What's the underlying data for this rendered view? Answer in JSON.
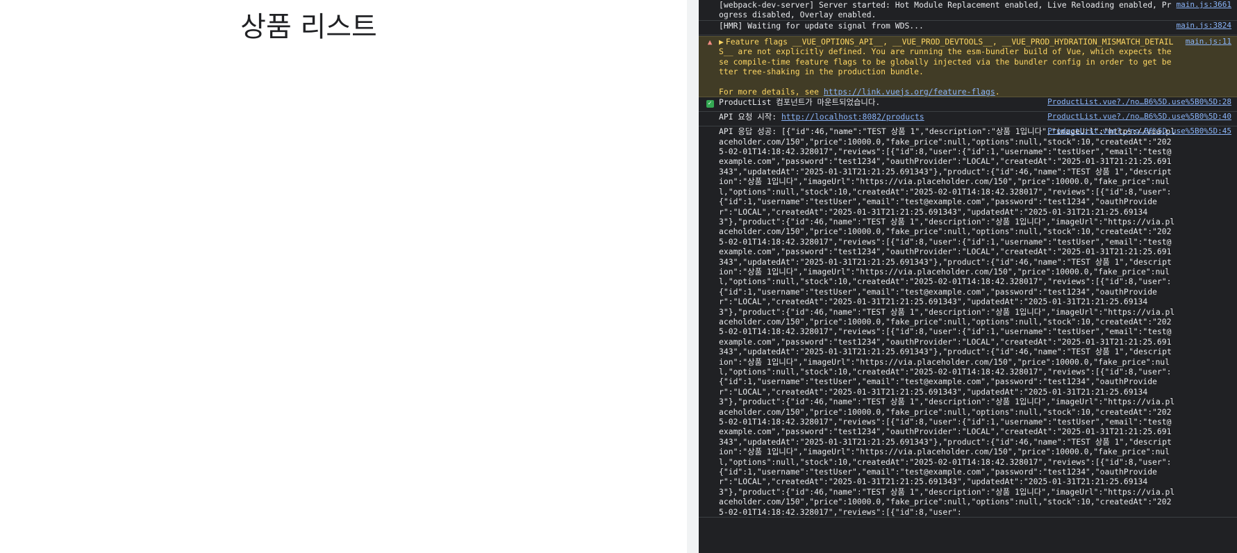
{
  "app": {
    "title": "상품 리스트"
  },
  "console": {
    "messages": [
      {
        "type": "log",
        "text": "[webpack-dev-server] Server started: Hot Module Replacement enabled, Live Reloading enabled, Progress disabled, Overlay enabled.",
        "source": "main.js:3661"
      },
      {
        "type": "log",
        "text": "[HMR] Waiting for update signal from WDS...",
        "source": "main.js:3824"
      },
      {
        "type": "warning",
        "text": "Feature flags __VUE_OPTIONS_API__, __VUE_PROD_DEVTOOLS__, __VUE_PROD_HYDRATION_MISMATCH_DETAILS__ are not explicitly defined. You are running the esm-bundler build of Vue, which expects these compile-time feature flags to be globally injected via the bundler config in order to get better tree-shaking in the production bundle.",
        "details_prefix": "For more details, see ",
        "details_link": "https://link.vuejs.org/feature-flags",
        "details_suffix": ".",
        "source": "main.js:11"
      },
      {
        "type": "log",
        "text": "ProductList 컴포넌트가 마운트되었습니다.",
        "source": "ProductList.vue?./no…B6%5D.use%5B0%5D:28"
      },
      {
        "type": "log",
        "text_prefix": "API 요청 시작: ",
        "link": "http://localhost:8082/products",
        "source": "ProductList.vue?./no…B6%5D.use%5B0%5D:40"
      },
      {
        "type": "log",
        "text": "API 응답 성공: [{\"id\":46,\"name\":\"TEST 상품 1\",\"description\":\"상품 1입니다\",\"imageUrl\":\"https://via.placeholder.com/150\",\"price\":10000.0,\"fake_price\":null,\"options\":null,\"stock\":10,\"createdAt\":\"2025-02-01T14:18:42.328017\",\"reviews\":[{\"id\":8,\"user\":{\"id\":1,\"username\":\"testUser\",\"email\":\"test@example.com\",\"password\":\"test1234\",\"oauthProvider\":\"LOCAL\",\"createdAt\":\"2025-01-31T21:21:25.691343\",\"updatedAt\":\"2025-01-31T21:21:25.691343\"},\"product\":{\"id\":46,\"name\":\"TEST 상품 1\",\"description\":\"상품 1입니다\",\"imageUrl\":\"https://via.placeholder.com/150\",\"price\":10000.0,\"fake_price\":null,\"options\":null,\"stock\":10,\"createdAt\":\"2025-02-01T14:18:42.328017\",\"reviews\":[{\"id\":8,\"user\":{\"id\":1,\"username\":\"testUser\",\"email\":\"test@example.com\",\"password\":\"test1234\",\"oauthProvider\":\"LOCAL\",\"createdAt\":\"2025-01-31T21:21:25.691343\",\"updatedAt\":\"2025-01-31T21:21:25.691343\"},\"product\":{\"id\":46,\"name\":\"TEST 상품 1\",\"description\":\"상품 1입니다\",\"imageUrl\":\"https://via.placeholder.com/150\",\"price\":10000.0,\"fake_price\":null,\"options\":null,\"stock\":10,\"createdAt\":\"2025-02-01T14:18:42.328017\",\"reviews\":[{\"id\":8,\"user\":{\"id\":1,\"username\":\"testUser\",\"email\":\"test@example.com\",\"password\":\"test1234\",\"oauthProvider\":\"LOCAL\",\"createdAt\":\"2025-01-31T21:21:25.691343\",\"updatedAt\":\"2025-01-31T21:21:25.691343\"},\"product\":{\"id\":46,\"name\":\"TEST 상품 1\",\"description\":\"상품 1입니다\",\"imageUrl\":\"https://via.placeholder.com/150\",\"price\":10000.0,\"fake_price\":null,\"options\":null,\"stock\":10,\"createdAt\":\"2025-02-01T14:18:42.328017\",\"reviews\":[{\"id\":8,\"user\":{\"id\":1,\"username\":\"testUser\",\"email\":\"test@example.com\",\"password\":\"test1234\",\"oauthProvider\":\"LOCAL\",\"createdAt\":\"2025-01-31T21:21:25.691343\",\"updatedAt\":\"2025-01-31T21:21:25.691343\"},\"product\":{\"id\":46,\"name\":\"TEST 상품 1\",\"description\":\"상품 1입니다\",\"imageUrl\":\"https://via.placeholder.com/150\",\"price\":10000.0,\"fake_price\":null,\"options\":null,\"stock\":10,\"createdAt\":\"2025-02-01T14:18:42.328017\",\"reviews\":[{\"id\":8,\"user\":{\"id\":1,\"username\":\"testUser\",\"email\":\"test@example.com\",\"password\":\"test1234\",\"oauthProvider\":\"LOCAL\",\"createdAt\":\"2025-01-31T21:21:25.691343\",\"updatedAt\":\"2025-01-31T21:21:25.691343\"},\"product\":{\"id\":46,\"name\":\"TEST 상품 1\",\"description\":\"상품 1입니다\",\"imageUrl\":\"https://via.placeholder.com/150\",\"price\":10000.0,\"fake_price\":null,\"options\":null,\"stock\":10,\"createdAt\":\"2025-02-01T14:18:42.328017\",\"reviews\":[{\"id\":8,\"user\":{\"id\":1,\"username\":\"testUser\",\"email\":\"test@example.com\",\"password\":\"test1234\",\"oauthProvider\":\"LOCAL\",\"createdAt\":\"2025-01-31T21:21:25.691343\",\"updatedAt\":\"2025-01-31T21:21:25.691343\"},\"product\":{\"id\":46,\"name\":\"TEST 상품 1\",\"description\":\"상품 1입니다\",\"imageUrl\":\"https://via.placeholder.com/150\",\"price\":10000.0,\"fake_price\":null,\"options\":null,\"stock\":10,\"createdAt\":\"2025-02-01T14:18:42.328017\",\"reviews\":[{\"id\":8,\"user\":{\"id\":1,\"username\":\"testUser\",\"email\":\"test@example.com\",\"password\":\"test1234\",\"oauthProvider\":\"LOCAL\",\"createdAt\":\"2025-01-31T21:21:25.691343\",\"updatedAt\":\"2025-01-31T21:21:25.691343\"},\"product\":{\"id\":46,\"name\":\"TEST 상품 1\",\"description\":\"상품 1입니다\",\"imageUrl\":\"https://via.placeholder.com/150\",\"price\":10000.0,\"fake_price\":null,\"options\":null,\"stock\":10,\"createdAt\":\"2025-02-01T14:18:42.328017\",\"reviews\":[{\"id\":8,\"user\":{\"id\":1,\"username\":\"testUser\",\"email\":\"test@example.com\",\"password\":\"test1234\",\"oauthProvider\":\"LOCAL\",\"createdAt\":\"2025-01-31T21:21:25.691343\",\"updatedAt\":\"2025-01-31T21:21:25.691343\"},\"product\":{\"id\":46,\"name\":\"TEST 상품 1\",\"description\":\"상품 1입니다\",\"imageUrl\":\"https://via.placeholder.com/150\",\"price\":10000.0,\"fake_price\":null,\"options\":null,\"stock\":10,\"createdAt\":\"2025-02-01T14:18:42.328017\",\"reviews\":[{\"id\":8,\"user\":",
        "source": "ProductList.vue?./no…B6%5D.use%5B0%5D:45"
      }
    ]
  },
  "colors": {
    "console_bg": "#202124",
    "warning_bg": "#413c26",
    "warning_text": "#fdd663",
    "link": "#8ab4f8",
    "success_check": "#34a853"
  },
  "icons": {
    "warning": "warning-triangle-icon",
    "success": "checkbox-checked-icon",
    "expand": "triangle-right-icon"
  }
}
